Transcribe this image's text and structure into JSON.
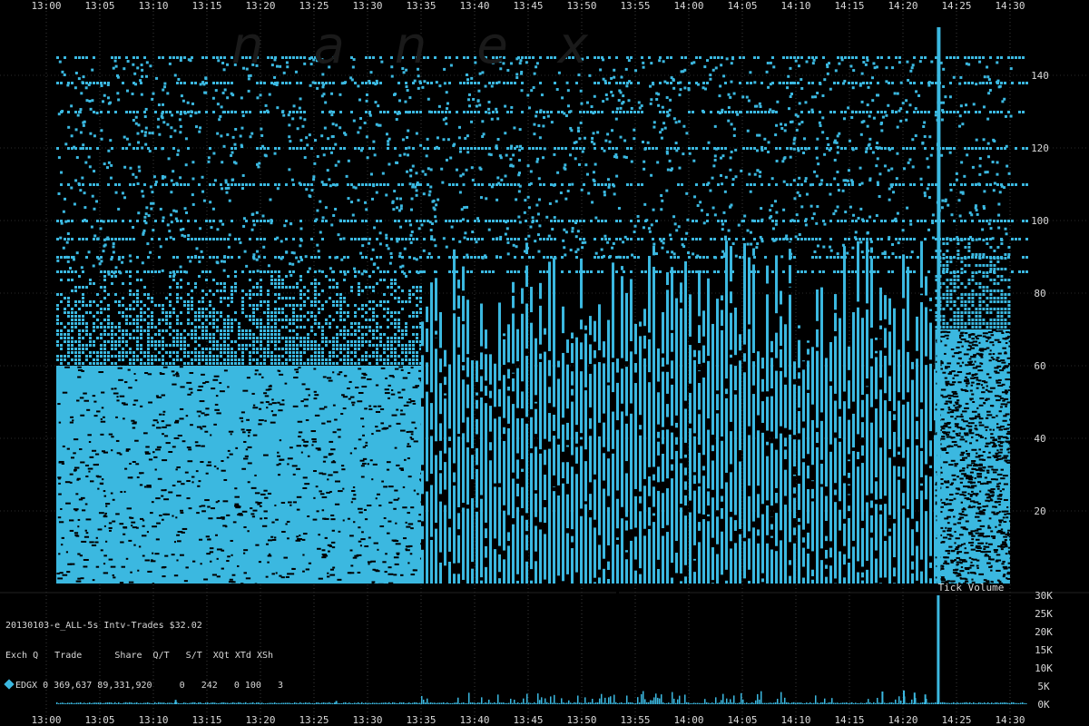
{
  "watermark": "nanex",
  "legend": {
    "title": "20130103-e_ALL-5s Intv-Trades $32.02",
    "header": "Exch Q   Trade      Share  Q/T   S/T  XQt XTd XSh",
    "row": "EDGX 0 369,637 89,331,920     0   242   0 100   3",
    "marker_color": "#3bb8e0"
  },
  "chart_data": [
    {
      "type": "scatter",
      "name": "interval-trades",
      "x_ticks": [
        "13:00",
        "13:05",
        "13:10",
        "13:15",
        "13:20",
        "13:25",
        "13:30",
        "13:35",
        "13:40",
        "13:45",
        "13:50",
        "13:55",
        "14:00",
        "14:05",
        "14:10",
        "14:15",
        "14:20",
        "14:25",
        "14:30"
      ],
      "y_ticks": [
        "20",
        "40",
        "60",
        "80",
        "100",
        "120",
        "140"
      ],
      "ylim": [
        0,
        150
      ],
      "xlim": [
        "13:00",
        "14:30"
      ],
      "color": "#3bb8e0",
      "grid": true,
      "regions": [
        {
          "from": "13:00",
          "to": "13:35",
          "dense_to": 60,
          "scatter_to": 150,
          "pattern": "dense"
        },
        {
          "from": "13:35",
          "to": "14:23",
          "dense_to": 90,
          "scatter_to": 150,
          "pattern": "columns"
        },
        {
          "from": "14:23",
          "to": "14:30",
          "dense_to": 70,
          "scatter_to": 150,
          "pattern": "dense"
        }
      ],
      "bands": [
        145,
        138,
        130,
        120,
        110,
        100,
        95,
        90,
        86
      ]
    },
    {
      "type": "bar",
      "name": "tick-volume",
      "title": "Tick Volume",
      "y_ticks": [
        "0K",
        "5K",
        "10K",
        "15K",
        "20K",
        "25K",
        "30K"
      ],
      "ylim": [
        0,
        30000
      ],
      "color": "#3bb8e0",
      "baseline": 400,
      "spike": {
        "at": "14:23",
        "value": 30000
      },
      "bumps": [
        {
          "at": "13:12",
          "value": 1200
        },
        {
          "at": "13:27",
          "value": 900
        },
        {
          "at": "14:18",
          "value": 3500
        },
        {
          "at": "14:20",
          "value": 3800
        },
        {
          "at": "14:21",
          "value": 3200
        },
        {
          "at": "14:22",
          "value": 2700
        }
      ]
    }
  ]
}
